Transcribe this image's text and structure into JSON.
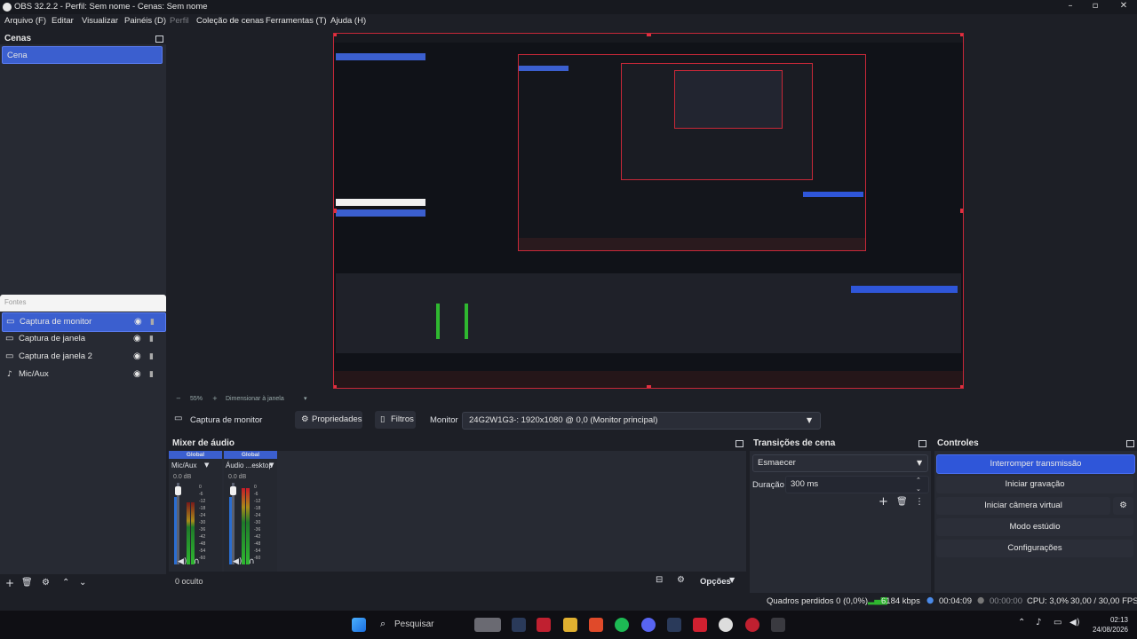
{
  "window": {
    "title": "OBS 32.2.2 - Perfil: Sem nome - Cenas: Sem nome"
  },
  "menu": [
    "Arquivo (F)",
    "Editar",
    "Visualizar",
    "Painéis (D)",
    "Perfil",
    "Coleção de cenas",
    "Ferramentas (T)",
    "Ajuda (H)"
  ],
  "scenes": {
    "header": "Cenas",
    "items": [
      "Cena"
    ]
  },
  "sources": {
    "header": "Fontes",
    "items": [
      "Captura de monitor",
      "Captura de janela",
      "Captura de janela 2",
      "Mic/Aux"
    ]
  },
  "preview": {
    "zoom": "55%",
    "scale_label": "Dimensionar à janela"
  },
  "source_toolbar": {
    "source_name": "Captura de monitor",
    "properties": "Propriedades",
    "filters": "Filtros",
    "monitor_label": "Monitor",
    "monitor_value": "24G2W1G3-: 1920x1080 @ 0,0 (Monitor principal)"
  },
  "mixer": {
    "header": "Mixer de áudio",
    "channels": [
      {
        "tag": "Global",
        "name": "Mic/Aux",
        "db": "0.0 dB"
      },
      {
        "tag": "Global",
        "name": "Áudio ...esktop",
        "db": "0.0 dB"
      }
    ],
    "scale": [
      "0",
      "-6",
      "-12",
      "-18",
      "-24",
      "-30",
      "-36",
      "-42",
      "-48",
      "-54",
      "-60"
    ],
    "hidden": "0 oculto",
    "options": "Opções"
  },
  "transitions": {
    "header": "Transições de cena",
    "selected": "Esmaecer",
    "duration_label": "Duração",
    "duration_value": "300 ms"
  },
  "controls": {
    "header": "Controles",
    "buttons": [
      "Interromper transmissão",
      "Iniciar gravação",
      "Iniciar câmera virtual",
      "Modo estúdio",
      "Configurações"
    ]
  },
  "status": {
    "dropped": "Quadros perdidos 0 (0,0%)",
    "bitrate": "6184 kbps",
    "stream_time": "00:04:09",
    "rec_time": "00:00:00",
    "cpu": "CPU: 3,0%",
    "fps": "30,00 / 30,00 FPS"
  },
  "taskbar": {
    "search": "Pesquisar",
    "time": "02:13",
    "date": "24/08/2026"
  },
  "colors": {
    "accent": "#2f56d9",
    "preview_border": "#c82838",
    "meter_green": "#2fb830"
  }
}
